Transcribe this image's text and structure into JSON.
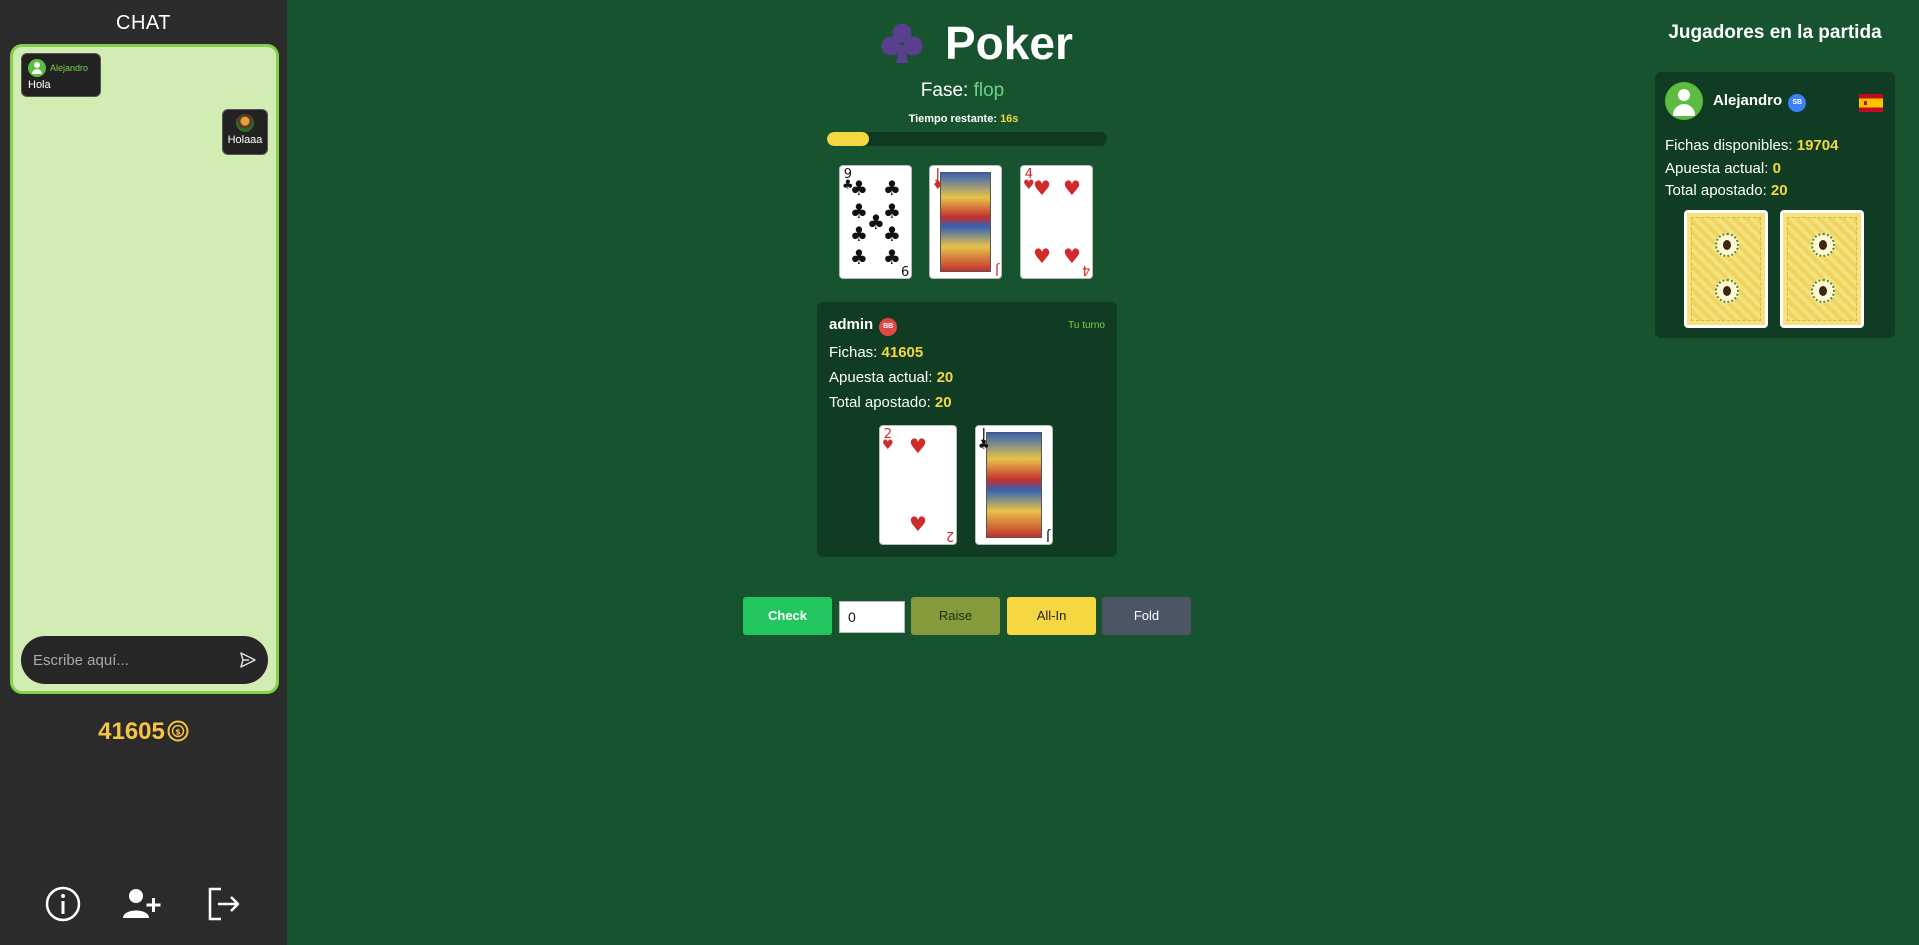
{
  "chat": {
    "title": "CHAT",
    "messages": [
      {
        "user": "Alejandro",
        "text": "Hola"
      },
      {
        "user": "",
        "text": "Holaaa"
      }
    ],
    "input_placeholder": "Escribe aquí..."
  },
  "balance": "41605",
  "game": {
    "title": "Poker",
    "phase_label": "Fase:",
    "phase_value": "flop",
    "timer_label": "Tiempo restante:",
    "timer_value": "16s",
    "timer_progress": 0.15,
    "community_cards": [
      {
        "rank": "9",
        "suit": "♣"
      },
      {
        "rank": "J",
        "suit": "♦"
      },
      {
        "rank": "4",
        "suit": "♥"
      }
    ]
  },
  "player": {
    "name": "admin",
    "badge": "BB",
    "turn_label": "Tu turno",
    "chips_label": "Fichas:",
    "chips": "41605",
    "bet_label": "Apuesta actual:",
    "bet": "20",
    "total_label": "Total apostado:",
    "total": "20",
    "hand": [
      {
        "rank": "2",
        "suit": "♥"
      },
      {
        "rank": "J",
        "suit": "♣"
      }
    ]
  },
  "actions": {
    "check": "Check",
    "bet_value": "0",
    "raise": "Raise",
    "allin": "All-In",
    "fold": "Fold"
  },
  "opponents": {
    "title": "Jugadores en la partida",
    "list": [
      {
        "name": "Alejandro",
        "badge": "SB",
        "chips_label": "Fichas disponibles:",
        "chips": "19704",
        "bet_label": "Apuesta actual:",
        "bet": "0",
        "total_label": "Total apostado:",
        "total": "20"
      }
    ]
  },
  "colors": {
    "table": "#17532f",
    "accent_yellow": "#f5d742",
    "accent_green": "#22c55e"
  }
}
